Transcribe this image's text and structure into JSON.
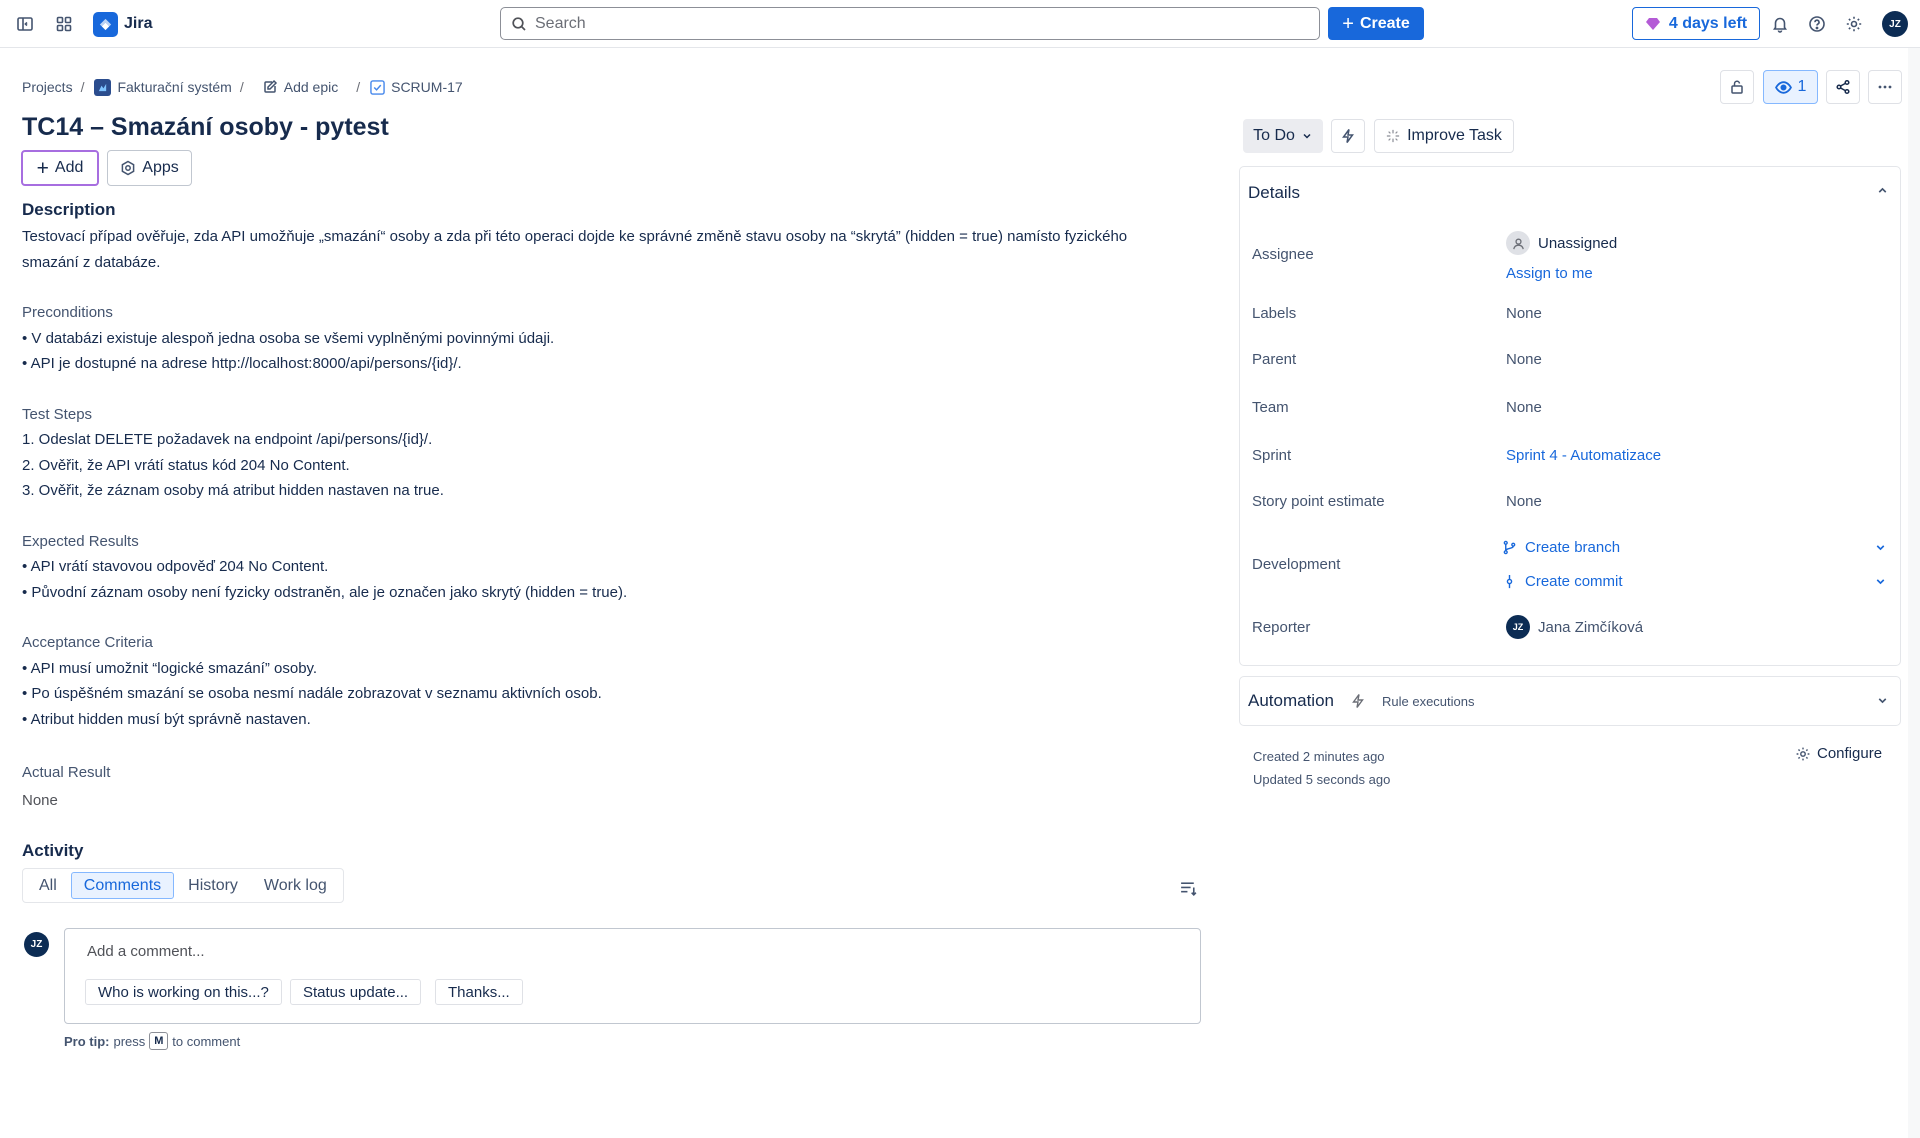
{
  "topbar": {
    "app_name": "Jira",
    "search_placeholder": "Search",
    "create_label": "Create",
    "trial_label": "4 days left",
    "user_initials": "JZ"
  },
  "breadcrumb": {
    "projects": "Projects",
    "project": "Fakturační systém",
    "add_epic": "Add epic",
    "issue_key": "SCRUM-17"
  },
  "header": {
    "watch_count": "1"
  },
  "issue": {
    "title": "TC14 – Smazání osoby - pytest",
    "add_label": "Add",
    "apps_label": "Apps"
  },
  "description": {
    "heading": "Description",
    "intro_line1": "Testovací případ ověřuje, zda API umožňuje „smazání“ osoby a zda při této operaci dojde ke správné změně stavu osoby na “skrytá” (hidden = true) namísto fyzického",
    "intro_line2": "smazání z databáze.",
    "preconditions": {
      "heading": "Preconditions",
      "items": [
        "• V databázi existuje alespoň jedna osoba se všemi vyplněnými povinnými údaji.",
        "• API je dostupné na adrese http://localhost:8000/api/persons/{id}/."
      ]
    },
    "test_steps": {
      "heading": "Test Steps",
      "items": [
        "1. Odeslat DELETE požadavek na endpoint /api/persons/{id}/.",
        "2. Ověřit, že API vrátí status kód 204 No Content.",
        "3. Ověřit, že záznam osoby má atribut hidden nastaven na true."
      ]
    },
    "expected_results": {
      "heading": "Expected Results",
      "items": [
        "• API vrátí stavovou odpověď 204 No Content.",
        "• Původní záznam osoby není fyzicky odstraněn, ale je označen jako skrytý (hidden = true)."
      ]
    },
    "acceptance_criteria": {
      "heading": "Acceptance Criteria",
      "items": [
        "• API musí umožnit “logické smazání” osoby.",
        "• Po úspěšném smazání se osoba nesmí nadále zobrazovat v seznamu aktivních osob.",
        "• Atribut hidden musí být správně nastaven."
      ]
    },
    "actual_result": {
      "heading": "Actual Result",
      "value": "None"
    }
  },
  "status": {
    "label": "To Do",
    "improve_label": "Improve Task"
  },
  "details": {
    "heading": "Details",
    "assignee_label": "Assignee",
    "assignee_value": "Unassigned",
    "assign_to_me": "Assign to me",
    "labels_label": "Labels",
    "labels_value": "None",
    "parent_label": "Parent",
    "parent_value": "None",
    "team_label": "Team",
    "team_value": "None",
    "sprint_label": "Sprint",
    "sprint_value": "Sprint 4 - Automatizace",
    "story_points_label": "Story point estimate",
    "story_points_value": "None",
    "development_label": "Development",
    "create_branch": "Create branch",
    "create_commit": "Create commit",
    "reporter_label": "Reporter",
    "reporter_initials": "JZ",
    "reporter_name": "Jana Zimčíková"
  },
  "automation": {
    "heading": "Automation",
    "rule_executions": "Rule executions"
  },
  "meta": {
    "created": "Created 2 minutes ago",
    "updated": "Updated 5 seconds ago",
    "configure": "Configure"
  },
  "activity": {
    "heading": "Activity",
    "tabs": [
      "All",
      "Comments",
      "History",
      "Work log"
    ],
    "active_tab": "Comments",
    "comment_placeholder": "Add a comment...",
    "quick_replies": [
      "Who is working on this...?",
      "Status update...",
      "Thanks..."
    ],
    "pro_tip_bold": "Pro tip:",
    "pro_tip_press": "press",
    "pro_tip_key": "M",
    "pro_tip_rest": "to comment",
    "user_initials": "JZ"
  },
  "colors": {
    "accent": "#1868db",
    "trial": "#1868db",
    "avatar": "#0c2c54"
  }
}
